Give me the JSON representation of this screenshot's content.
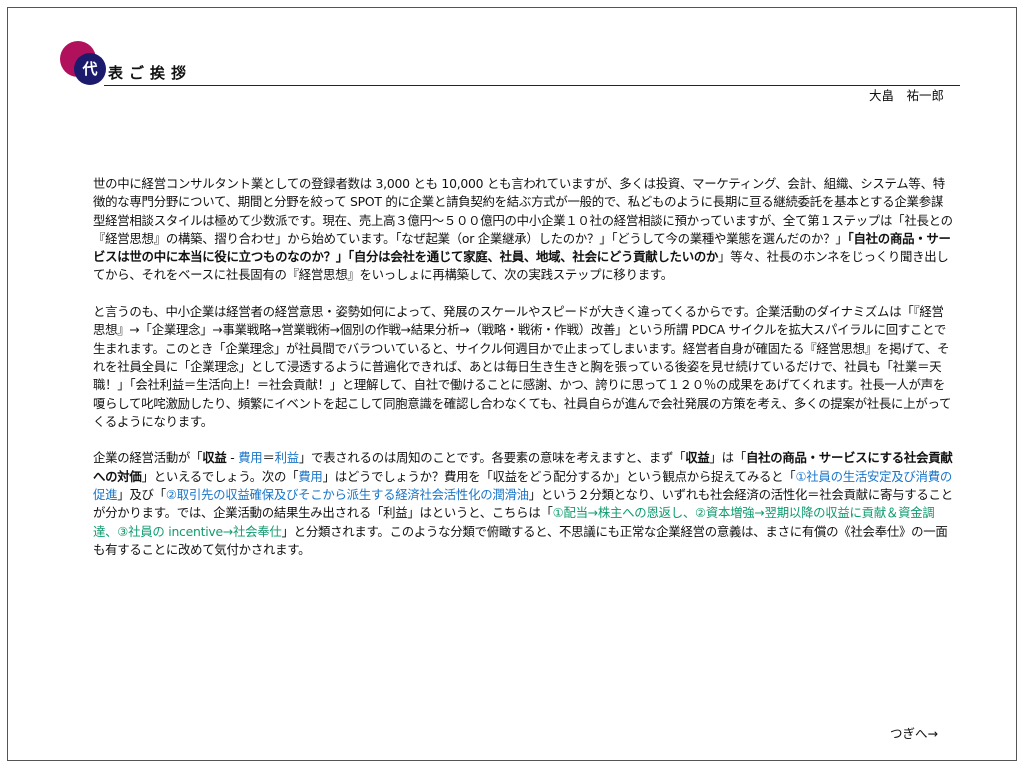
{
  "header": {
    "title_first_char": "代",
    "title_rest": "表ご挨拶",
    "author": "大畠　祐一郎",
    "colors": {
      "logo_pink": "#b0105c",
      "logo_navy": "#1c1a6c"
    }
  },
  "body": {
    "p1": {
      "s1": "世の中に経営コンサルタント業としての登録者数は 3,000 とも 10,000 とも言われていますが、多くは投資、マーケティング、会計、組織、システム等、特徴的な専門分野について、期間と分野を絞って SPOT 的に企業と請負契約を結ぶ方式が一般的で、私どものように長期に亘る継続委託を基本とする企業参謀型経営相談スタイルは極めて少数派です。現在、売上高３億円～５００億円の中小企業１０社の経営相談に預かっていますが、全て第１ステップは「社長との『経営思想』の構築、摺り合わせ」から始めています。「なぜ起業（or 企業継承）したのか？」「どうして今の業種や業態を選んだのか？」",
      "s2": "「自社の商品・サービスは世の中に本当に役に立つものなのか？」「自分は会社を通じて家庭、社員、地域、社会にどう貢献したいのか",
      "s3": "」等々、社長のホンネをじっくり聞き出してから、それをベースに社長固有の『経営思想』をいっしょに再構築して、次の実践ステップに移ります。"
    },
    "p2": "と言うのも、中小企業は経営者の経営意思・姿勢如何によって、発展のスケールやスピードが大きく違ってくるからです。企業活動のダイナミズムは「『経営思想』→「企業理念」→事業戦略→営業戦術→個別の作戦→結果分析→（戦略・戦術・作戦）改善」という所謂 PDCA サイクルを拡大スパイラルに回すことで生まれます。このとき「企業理念」が社員間でバラついていると、サイクル何週目かで止まってしまいます。経営者自身が確固たる『経営思想』を掲げて、それを社員全員に「企業理念」として浸透するように普遍化できれば、あとは毎日生き生きと胸を張っている後姿を見せ続けているだけで、社員も「社業＝天職！」「会社利益＝生活向上！＝社会貢献！」と理解して、自社で働けることに感謝、かつ、誇りに思って１２０％の成果をあげてくれます。社長一人が声を嗄らして叱咤激励したり、頻繁にイベントを起こして同胞意識を確認し合わなくても、社員自らが進んで会社発展の方策を考え、多くの提案が社長に上がってくるようになります。",
    "p3": {
      "t1": "企業の経営活動が「",
      "t2": "収益",
      "t3": " - ",
      "t4": "費用",
      "t5": "＝",
      "t6": "利益",
      "t7": "」で表されるのは周知のことです。各要素の意味を考えますと、まず「",
      "t8": "収益",
      "t9": "」は「",
      "t10": "自社の商品・サービスにする社会貢献への対価",
      "t11": "」といえるでしょう。次の「",
      "t12": "費用",
      "t13": "」はどうでしょうか？費用を「収益をどう配分するか」という観点から捉えてみると「",
      "t14": "①社員の生活安定及び消費の促進",
      "t15": "」及び「",
      "t16": "②取引先の収益確保及びそこから派生する経済社会活性化の潤滑油",
      "t17": "」という２分類となり、いずれも社会経済の活性化＝社会貢献に寄与することが分かります。では、企業活動の結果生み出される「利益」はというと、こちらは「",
      "t18": "①配当→株主への恩返し、②資本増強→翌期以降の収益に貢献＆資金調達、③社員の incentive→社会奉仕",
      "t19": "」と分類されます。このような分類で俯瞰すると、不思議にも正常な企業経営の意義は、まさに有償の《社会奉仕》の一面も有することに改めて気付かされます。"
    }
  },
  "footer": {
    "next_label": "つぎへ→"
  }
}
